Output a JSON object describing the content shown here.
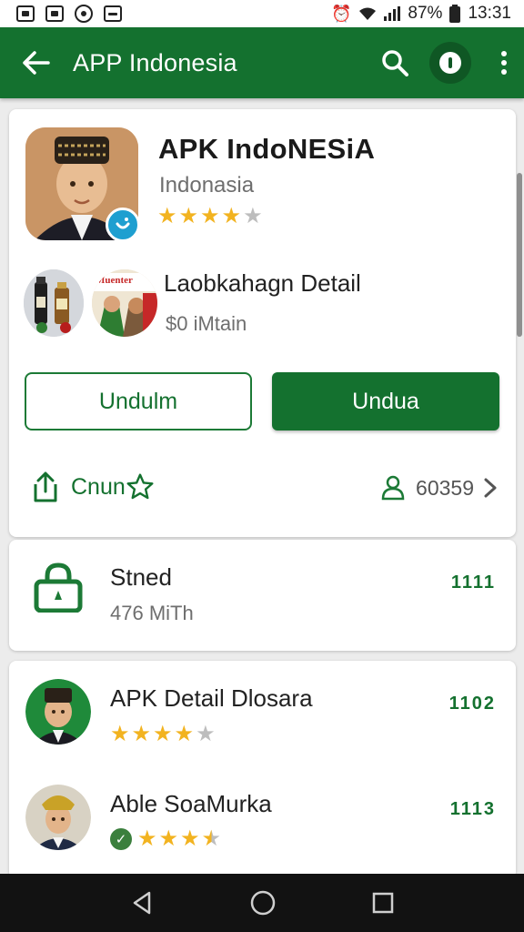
{
  "status_bar": {
    "battery": "87%",
    "time": "13:31"
  },
  "appbar": {
    "title": "APP Indonesia",
    "back_icon": "arrow-left-icon",
    "search_icon": "search-icon",
    "info_icon": "info-icon",
    "more_icon": "more-vert-icon"
  },
  "app": {
    "title": "APK IndoNESiA",
    "subtitle": "Indonasia",
    "rating": 4,
    "detail_title": "Laobkahagn Detail",
    "detail_sub": "$0 iMtain",
    "thumb2_label": "Muenter"
  },
  "buttons": {
    "secondary": "Undulm",
    "primary": "Undua"
  },
  "actions": {
    "share_label": "Cnun",
    "count": "60359"
  },
  "info_card": {
    "title": "Stned",
    "subtitle": "476 MiTh",
    "value": "1111"
  },
  "list": [
    {
      "title": "APK Detail Dlosara",
      "rating": 4,
      "value": "1102"
    },
    {
      "title": "Able SoaMurka",
      "rating": 3.5,
      "value": "1113",
      "verified": true
    }
  ],
  "colors": {
    "brand": "#14712f",
    "star": "#f2b320",
    "badge": "#1e9fd0"
  }
}
